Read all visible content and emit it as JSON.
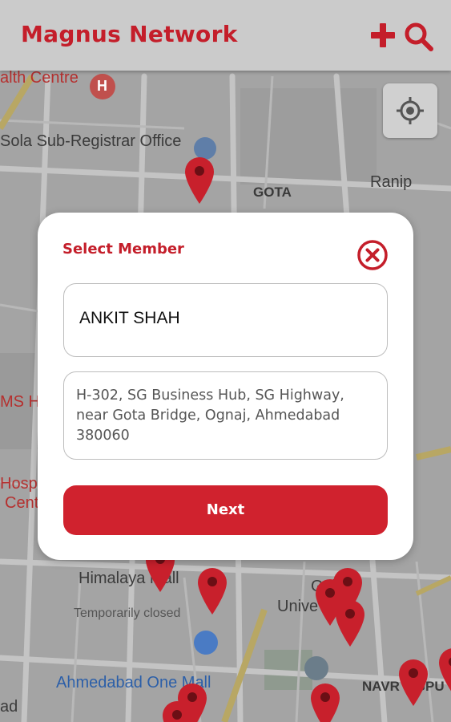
{
  "header": {
    "title": "Magnus Network",
    "add_icon": "plus-icon",
    "search_icon": "search-icon",
    "accent_color": "#c41e2a"
  },
  "map": {
    "labels": {
      "health_centre": "alth Centre",
      "sola_office": "Sola Sub-Registrar Office",
      "gota": "GOTA",
      "ranip": "Ranip",
      "ms_h": "MS H",
      "hospit": "Hospit",
      "cent": "Cent",
      "himalaya_mall": "Himalaya Mall",
      "temporarily_closed": "Temporarily closed",
      "gujarat_univ_1": "Guj",
      "gujarat_univ_2": "Unive",
      "ahmedabad_one_mall": "Ahmedabad One Mall",
      "navrangpura": "NAVR    GPU",
      "ad": "ad"
    },
    "locate_icon": "my-location-icon",
    "marker_icon": "map-pin-icon"
  },
  "dialog": {
    "title": "Select Member",
    "close_icon": "close-circle-icon",
    "member_name": "ANKIT SHAH",
    "member_address": "H-302, SG Business Hub, SG Highway, near Gota Bridge, Ognaj, Ahmedabad 380060",
    "next_label": "Next",
    "button_color": "#d0222e"
  }
}
